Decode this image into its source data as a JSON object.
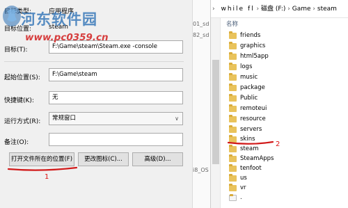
{
  "dialog": {
    "top_rows": [
      {
        "label": "目标类型:",
        "value": "应用程序"
      },
      {
        "label": "目标位置:",
        "value": "steam"
      }
    ],
    "target_label": "目标(T):",
    "target_value": "F:\\Game\\steam\\Steam.exe -console",
    "start_in_label": "起始位置(S):",
    "start_in_value": "F:\\Game\\steam",
    "shortcut_key_label": "快捷键(K):",
    "shortcut_key_value": "无",
    "run_label": "运行方式(R):",
    "run_value": "常规窗口",
    "comment_label": "备注(O):",
    "comment_value": "",
    "buttons": {
      "open_location": "打开文件所在的位置(F)",
      "change_icon": "更改图标(C)...",
      "advanced": "高级(D)..."
    }
  },
  "watermark": {
    "title": "河东软件园",
    "url": "www.pc0359.cn"
  },
  "middle_window": {
    "fragments": [
      "01_sd",
      "82_sd",
      "i8_OS"
    ]
  },
  "explorer": {
    "address_prefix": "while fl",
    "breadcrumbs": [
      "磁盘 (F:)",
      "Game",
      "steam"
    ],
    "column_header": "名称",
    "items": [
      "friends",
      "graphics",
      "html5app",
      "logs",
      "music",
      "package",
      "Public",
      "remoteui",
      "resource",
      "servers",
      "skins",
      "steam",
      "SteamApps",
      "tenfoot",
      "us",
      "vr",
      "."
    ]
  },
  "annotations": {
    "label_1": "1",
    "label_2": "2",
    "color": "#d11a1a"
  }
}
